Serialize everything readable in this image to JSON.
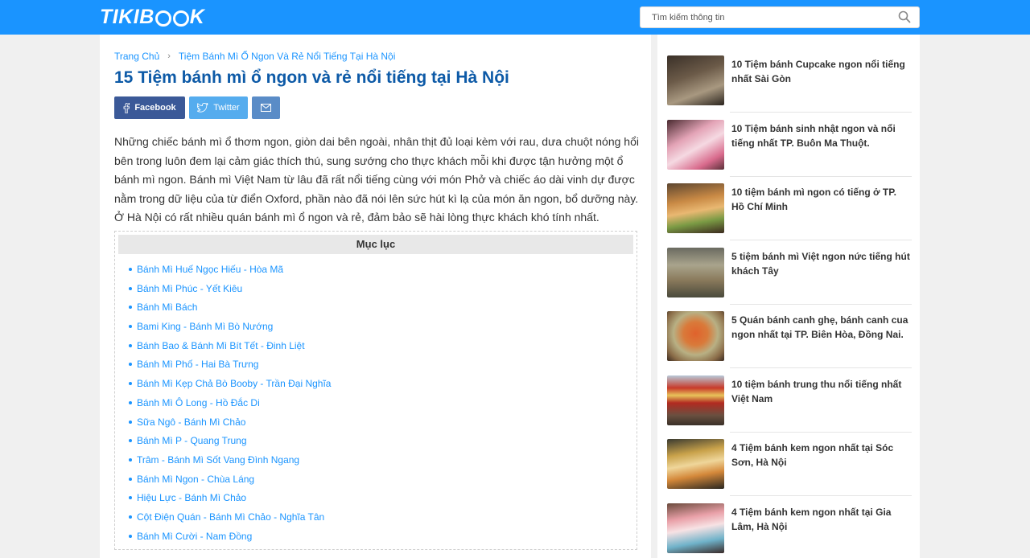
{
  "header": {
    "logo_text": "TIKIBOOK",
    "search_placeholder": "Tìm kiếm thông tin"
  },
  "breadcrumb": {
    "home": "Trang Chủ",
    "current": "Tiệm Bánh Mì Ổ Ngon Và Rẻ Nổi Tiếng Tại Hà Nội"
  },
  "article": {
    "title": "15 Tiệm bánh mì ổ ngon và rẻ nổi tiếng tại Hà Nội",
    "intro": "Những chiếc bánh mì ổ thơm ngon, giòn dai bên ngoài, nhân thịt đủ loại kèm với rau, dưa chuột nóng hổi bên trong luôn đem lại cảm giác thích thú, sung sướng cho thực khách mỗi khi được tận hưởng một ổ bánh mì ngon. Bánh mì Việt Nam từ lâu đã rất nổi tiếng cùng với món Phở và chiếc áo dài vinh dự được nằm trong dữ liệu của từ điển Oxford, phần nào đã nói lên sức hút kì lạ của món ăn ngon, bổ dưỡng này. Ở Hà Nội có rất nhiều quán bánh mì ổ ngon và rẻ, đảm bảo sẽ hài lòng thực khách khó tính nhất."
  },
  "share": {
    "facebook": "Facebook",
    "twitter": "Twitter",
    "mail_icon": "mail-icon",
    "colors": {
      "facebook": "#3b5998",
      "twitter": "#55acee",
      "mail": "#5a8cc7"
    }
  },
  "toc": {
    "heading": "Mục lục",
    "items": [
      "Bánh Mì Huế Ngọc Hiếu - Hòa Mã",
      "Bánh Mì Phúc - Yết Kiêu",
      "Bánh Mì Bách",
      "Bami King - Bánh Mì Bò Nướng",
      "Bánh Bao & Bánh Mì Bít Tết - Đinh Liệt",
      "Bánh Mì Phố - Hai Bà Trưng",
      "Bánh Mì Kẹp Chả Bò Booby - Trần Đại Nghĩa",
      "Bánh Mì Ô Long - Hồ Đắc Di",
      "Sữa Ngô - Bánh Mì Chảo",
      "Bánh Mì P - Quang Trung",
      "Trâm - Bánh Mì Sốt Vang Đình Ngang",
      "Bánh Mì Ngon - Chùa Láng",
      "Hiệu Lực - Bánh Mì Chảo",
      "Cột Điện Quán - Bánh Mì Chảo - Nghĩa Tân",
      "Bánh Mì Cười - Nam Đồng"
    ]
  },
  "sidebar": {
    "items": [
      {
        "title": "10 Tiệm bánh Cupcake ngon nổi tiếng nhất Sài Gòn"
      },
      {
        "title": "10 Tiệm bánh sinh nhật ngon và nổi tiếng nhất TP. Buôn Ma Thuột."
      },
      {
        "title": "10 tiệm bánh mì ngon có tiếng ở TP. Hồ Chí Minh"
      },
      {
        "title": "5 tiệm bánh mì Việt ngon nức tiếng hút khách Tây"
      },
      {
        "title": "5 Quán bánh canh ghẹ, bánh canh cua ngon nhất tại TP. Biên Hòa, Đồng Nai."
      },
      {
        "title": "10 tiệm bánh trung thu nổi tiếng nhất Việt Nam"
      },
      {
        "title": "4 Tiệm bánh kem ngon nhất tại Sóc Sơn, Hà Nội"
      },
      {
        "title": "4 Tiệm bánh kem ngon nhất tại Gia Lâm, Hà Nội"
      }
    ]
  },
  "colors": {
    "brand": "#1a94ff",
    "title": "#0d5aa7"
  }
}
